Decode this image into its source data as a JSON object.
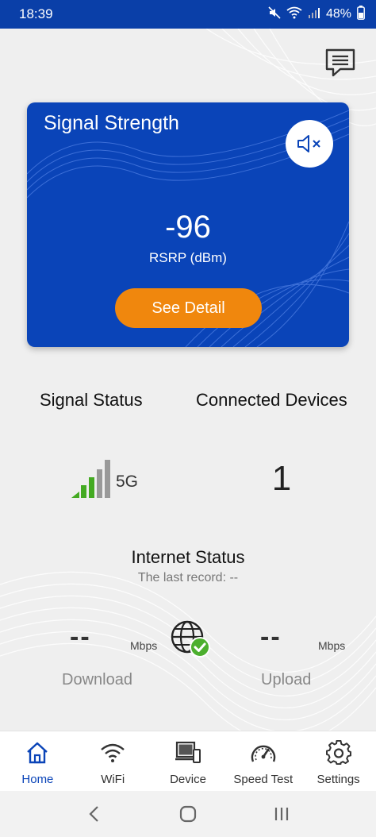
{
  "status_bar": {
    "time": "18:39",
    "battery": "48%",
    "icons": [
      "mute-icon",
      "wifi-icon",
      "cell-signal-icon",
      "battery-icon"
    ]
  },
  "header": {
    "chat_icon": "chat-icon"
  },
  "signal_card": {
    "title": "Signal Strength",
    "value": "-96",
    "unit_label": "RSRP (dBm)",
    "detail_button": "See Detail",
    "mute_icon": "speaker-muted-icon",
    "accent": "#0a44b8",
    "button_color": "#f0870d"
  },
  "status": {
    "signal_status_label": "Signal Status",
    "connected_devices_label": "Connected Devices",
    "network_type": "5G",
    "signal_bars_active": 3,
    "signal_bars_total": 5,
    "connected_count": "1"
  },
  "internet": {
    "title": "Internet Status",
    "last_record": "The last record: --",
    "download": {
      "value": "--",
      "unit": "Mbps",
      "label": "Download"
    },
    "upload": {
      "value": "--",
      "unit": "Mbps",
      "label": "Upload"
    },
    "status_icon": "globe-connected-icon"
  },
  "bottom_nav": {
    "items": [
      {
        "label": "Home",
        "icon": "home-icon",
        "active": true
      },
      {
        "label": "WiFi",
        "icon": "wifi-icon",
        "active": false
      },
      {
        "label": "Device",
        "icon": "device-icon",
        "active": false
      },
      {
        "label": "Speed Test",
        "icon": "speedometer-icon",
        "active": false
      },
      {
        "label": "Settings",
        "icon": "gear-icon",
        "active": false
      }
    ]
  },
  "system_nav": [
    "back-icon",
    "home-circle-icon",
    "recents-icon"
  ]
}
